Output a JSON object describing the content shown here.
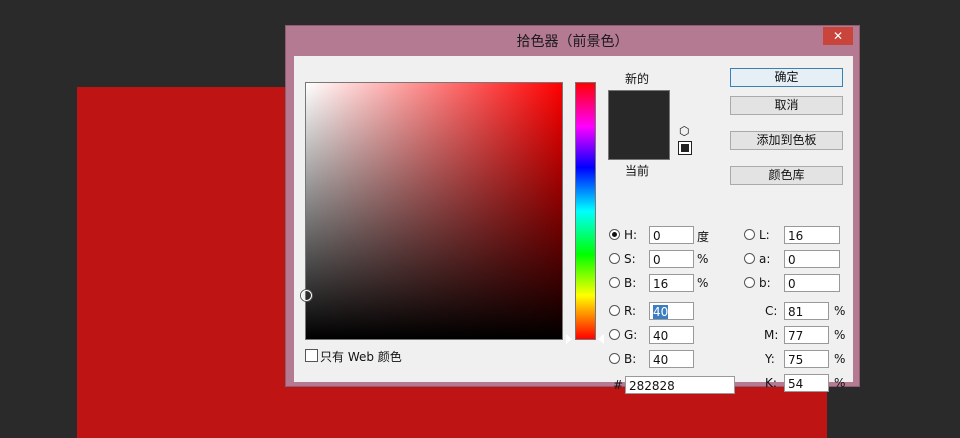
{
  "dialog": {
    "title": "拾色器（前景色）",
    "close": "✕"
  },
  "swatch": {
    "new_label": "新的",
    "current_label": "当前",
    "color": "#282828"
  },
  "buttons": {
    "ok": "确定",
    "cancel": "取消",
    "add_swatch": "添加到色板",
    "color_library": "颜色库"
  },
  "hsb": {
    "h_label": "H:",
    "h": "0",
    "h_unit": "度",
    "s_label": "S:",
    "s": "0",
    "s_unit": "%",
    "b_label": "B:",
    "b": "16",
    "b_unit": "%"
  },
  "rgb": {
    "r_label": "R:",
    "r": "40",
    "g_label": "G:",
    "g": "40",
    "b_label": "B:",
    "b": "40"
  },
  "lab": {
    "l_label": "L:",
    "l": "16",
    "a_label": "a:",
    "a": "0",
    "b_label": "b:",
    "b": "0"
  },
  "cmyk": {
    "c_label": "C:",
    "c": "81",
    "m_label": "M:",
    "m": "77",
    "y_label": "Y:",
    "y": "75",
    "k_label": "K:",
    "k": "54",
    "unit": "%"
  },
  "hex": {
    "label": "#",
    "value": "282828"
  },
  "web_only": {
    "label": "只有 Web 颜色"
  },
  "colors": {
    "canvas": "#be1414",
    "dialog_frame": "#b47a91",
    "close_button": "#c9443a"
  }
}
